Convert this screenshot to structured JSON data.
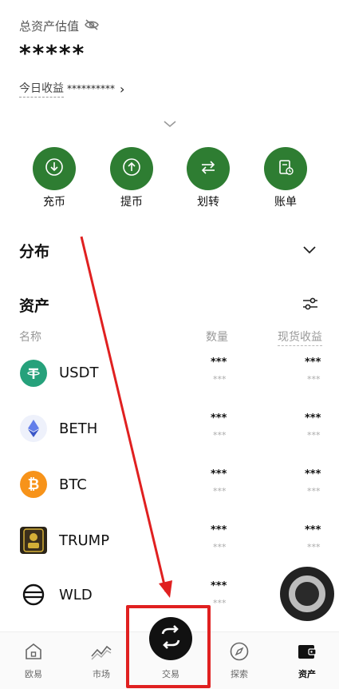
{
  "header": {
    "total_label": "总资产估值",
    "total_value": "*****",
    "today_label": "今日收益",
    "today_value": "**********",
    "today_arrow": "›"
  },
  "actions": [
    {
      "label": "充币",
      "icon": "deposit-icon"
    },
    {
      "label": "提币",
      "icon": "withdraw-icon"
    },
    {
      "label": "划转",
      "icon": "transfer-icon"
    },
    {
      "label": "账单",
      "icon": "bill-icon"
    }
  ],
  "distribution": {
    "title": "分布"
  },
  "assets": {
    "title": "资产",
    "columns": {
      "name": "名称",
      "qty": "数量",
      "pnl": "现货收益"
    },
    "rows": [
      {
        "name": "USDT",
        "qty": "***",
        "qty_sub": "***",
        "pnl": "***",
        "pnl_sub": "***"
      },
      {
        "name": "BETH",
        "qty": "***",
        "qty_sub": "***",
        "pnl": "***",
        "pnl_sub": "***"
      },
      {
        "name": "BTC",
        "qty": "***",
        "qty_sub": "***",
        "pnl": "***",
        "pnl_sub": "***"
      },
      {
        "name": "TRUMP",
        "qty": "***",
        "qty_sub": "***",
        "pnl": "***",
        "pnl_sub": "***"
      },
      {
        "name": "WLD",
        "qty": "***",
        "qty_sub": "***",
        "pnl": "",
        "pnl_sub": ""
      }
    ]
  },
  "nav": [
    {
      "label": "欧易",
      "icon": "home-icon"
    },
    {
      "label": "市场",
      "icon": "market-icon"
    },
    {
      "label": "交易",
      "icon": "trade-icon"
    },
    {
      "label": "探索",
      "icon": "compass-icon"
    },
    {
      "label": "资产",
      "icon": "wallet-icon",
      "active": true
    }
  ],
  "colors": {
    "accent": "#2e7d32",
    "annotation": "#e02020",
    "usdt": "#26a17b",
    "btc": "#f7931a",
    "eth": "#627eea"
  }
}
